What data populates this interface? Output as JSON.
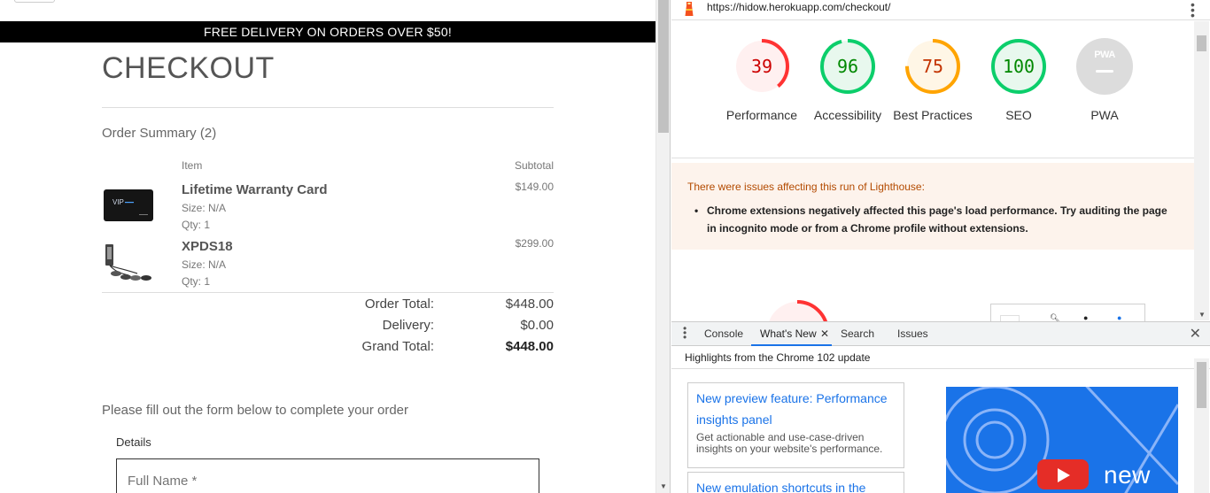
{
  "page": {
    "banner": "FREE DELIVERY ON ORDERS OVER $50!",
    "title": "CHECKOUT",
    "order_summary": "Order Summary (2)",
    "columns": {
      "item": "Item",
      "subtotal": "Subtotal"
    },
    "items": [
      {
        "name": "Lifetime Warranty Card",
        "size": "Size: N/A",
        "qty": "Qty: 1",
        "price": "$149.00",
        "image": "vip-card-image"
      },
      {
        "name": "XPDS18",
        "size": "Size: N/A",
        "qty": "Qty: 1",
        "price": "$299.00",
        "image": "device-image"
      }
    ],
    "totals": [
      {
        "label": "Order Total:",
        "value": "$448.00"
      },
      {
        "label": "Delivery:",
        "value": "$0.00"
      },
      {
        "label": "Grand Total:",
        "value": "$448.00"
      }
    ],
    "form_intro": "Please fill out the form below to complete your order",
    "details_label": "Details",
    "full_name_placeholder": "Full Name *"
  },
  "devtools": {
    "url": "https://hidow.herokuapp.com/checkout/",
    "scores": [
      {
        "value": "39",
        "label": "Performance",
        "color": "#ff3333",
        "fill": 0.39
      },
      {
        "value": "96",
        "label": "Accessibility",
        "color": "#0cce6b",
        "fill": 0.96
      },
      {
        "value": "75",
        "label": "Best Practices",
        "color": "#ffa400",
        "fill": 0.75
      },
      {
        "value": "100",
        "label": "SEO",
        "color": "#0cce6b",
        "fill": 1.0
      }
    ],
    "pwa": {
      "badge": "PWA",
      "label": "PWA"
    },
    "warning_title": "There were issues affecting this run of Lighthouse:",
    "warning_item": "Chrome extensions negatively affected this page's load performance. Try auditing the page in incognito mode or from a Chrome profile without extensions.",
    "drawer_tabs": [
      "Console",
      "What's New",
      "Search",
      "Issues"
    ],
    "whats_new_header": "Highlights from the Chrome 102 update",
    "cards": [
      {
        "title": "New preview feature: Performance insights panel",
        "body": "Get actionable and use-case-driven insights on your website's performance."
      },
      {
        "title": "New emulation shortcuts in the",
        "body": ""
      }
    ],
    "video_word": "new",
    "colors": {
      "accent": "#1a73e8",
      "warning_bg": "#fdf3ec"
    }
  }
}
